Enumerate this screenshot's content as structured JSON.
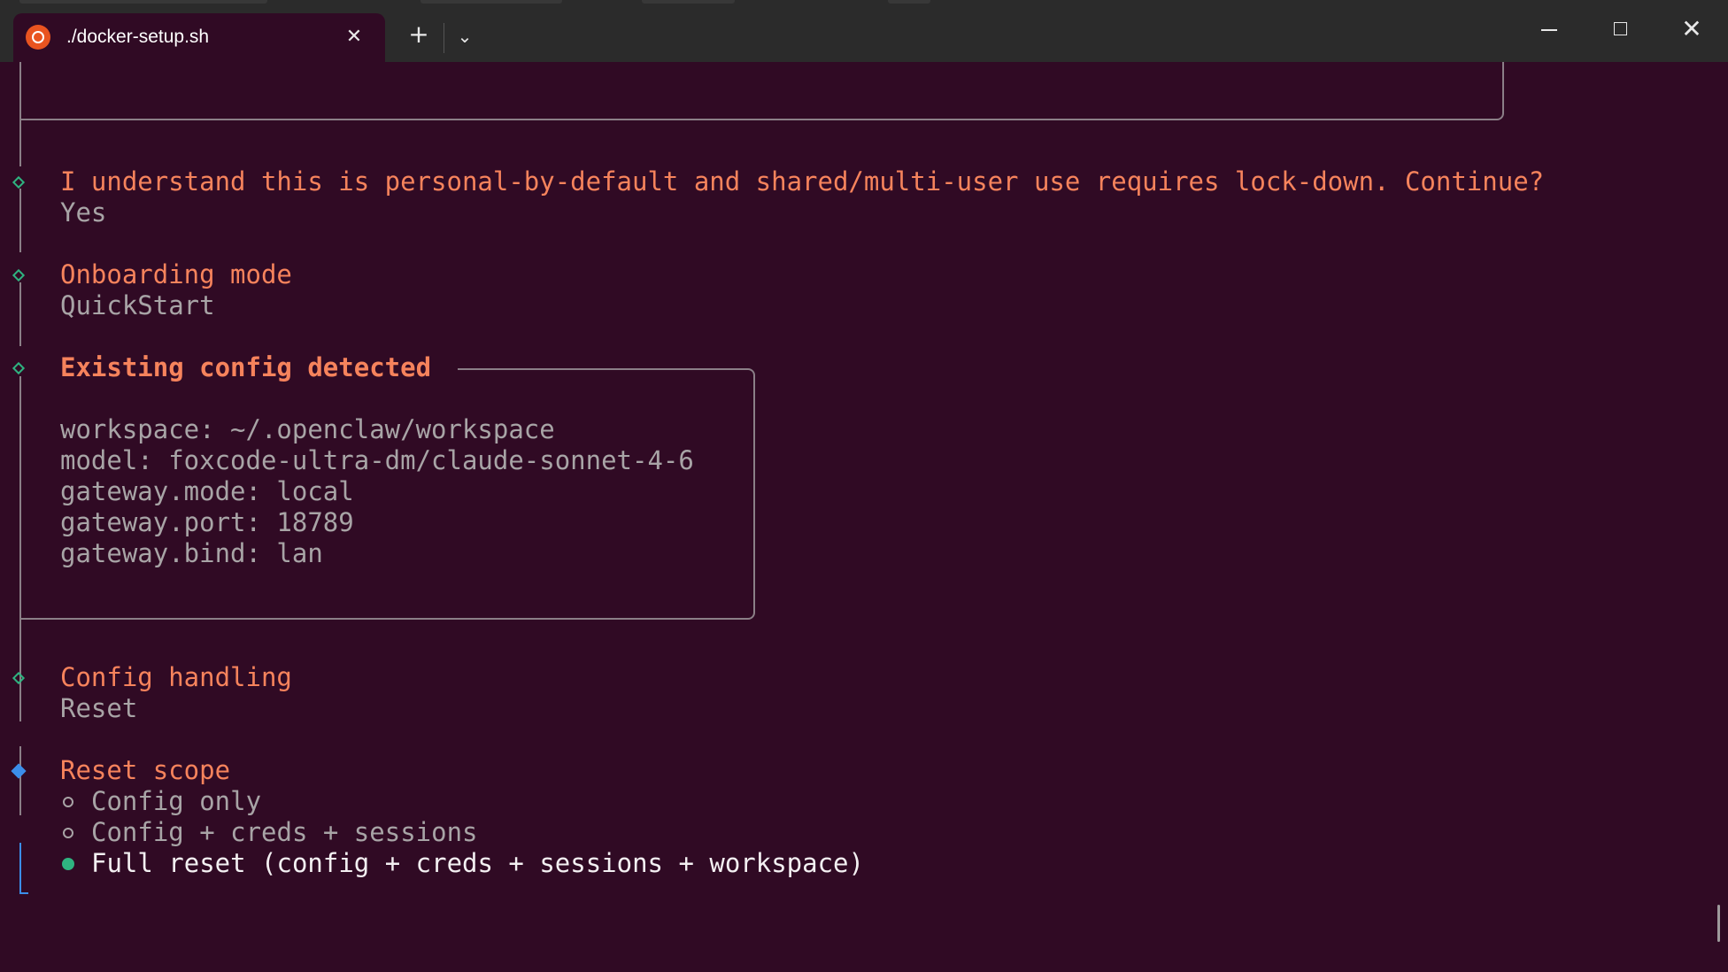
{
  "window": {
    "tab_title": "./docker-setup.sh",
    "tab_icon": "ubuntu-icon",
    "new_tab_glyph": "+",
    "dropdown_glyph": "⌄",
    "close_glyph": "✕",
    "colors": {
      "background": "#300a24",
      "heading": "#f6835c",
      "check": "#2fb380",
      "active": "#3b8eea"
    }
  },
  "steps": [
    {
      "question": "I understand this is personal-by-default and shared/multi-user use requires lock-down. Continue?",
      "answer": "Yes"
    },
    {
      "question": "Onboarding mode",
      "answer": "QuickStart"
    },
    {
      "question": "Config handling",
      "answer": "Reset"
    }
  ],
  "config_box": {
    "title": "Existing config detected",
    "lines": [
      "workspace: ~/.openclaw/workspace",
      "model: foxcode-ultra-dm/claude-sonnet-4-6",
      "gateway.mode: local",
      "gateway.port: 18789",
      "gateway.bind: lan"
    ]
  },
  "reset_scope": {
    "question": "Reset scope",
    "options": [
      {
        "label": "Config only",
        "selected": false
      },
      {
        "label": "Config + creds + sessions",
        "selected": false
      },
      {
        "label": "Full reset (config + creds + sessions + workspace)",
        "selected": true
      }
    ]
  }
}
